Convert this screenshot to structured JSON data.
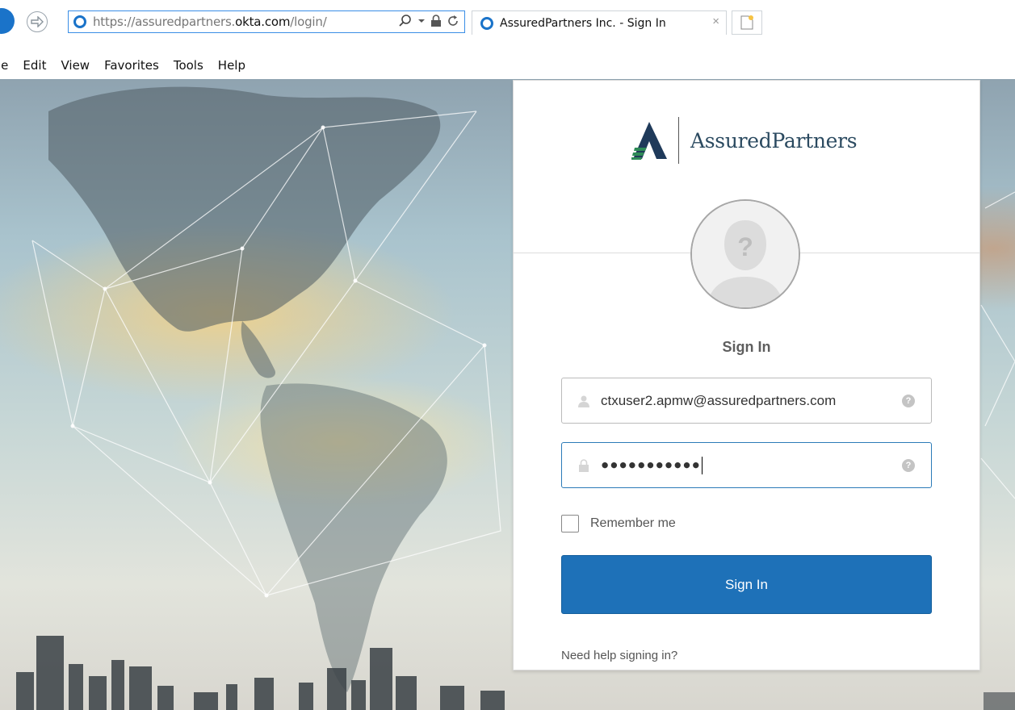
{
  "browser": {
    "url_prefix": "https://assuredpartners.",
    "url_domain": "okta.com",
    "url_suffix": "/login/",
    "tab_title": "AssuredPartners Inc. - Sign In",
    "tab_close": "×",
    "menu": [
      "le",
      "Edit",
      "View",
      "Favorites",
      "Tools",
      "Help"
    ]
  },
  "login": {
    "logo_text": "AssuredPartners",
    "title": "Sign In",
    "username_value": "ctxuser2.apmw@assuredpartners.com",
    "password_mask": "●●●●●●●●●●●",
    "help_glyph": "?",
    "avatar_glyph": "?",
    "remember_label": "Remember me",
    "submit_label": "Sign In",
    "help_link": "Need help signing in?"
  },
  "colors": {
    "primary_button": "#1e71b8",
    "logo_green": "#2e8b57",
    "logo_navy": "#1f3a5a"
  },
  "icons": {
    "back": "back-arrow-icon",
    "forward": "forward-arrow-icon",
    "search": "search-icon",
    "lock": "lock-icon",
    "refresh": "refresh-icon",
    "user": "user-icon",
    "password": "lock-icon"
  }
}
